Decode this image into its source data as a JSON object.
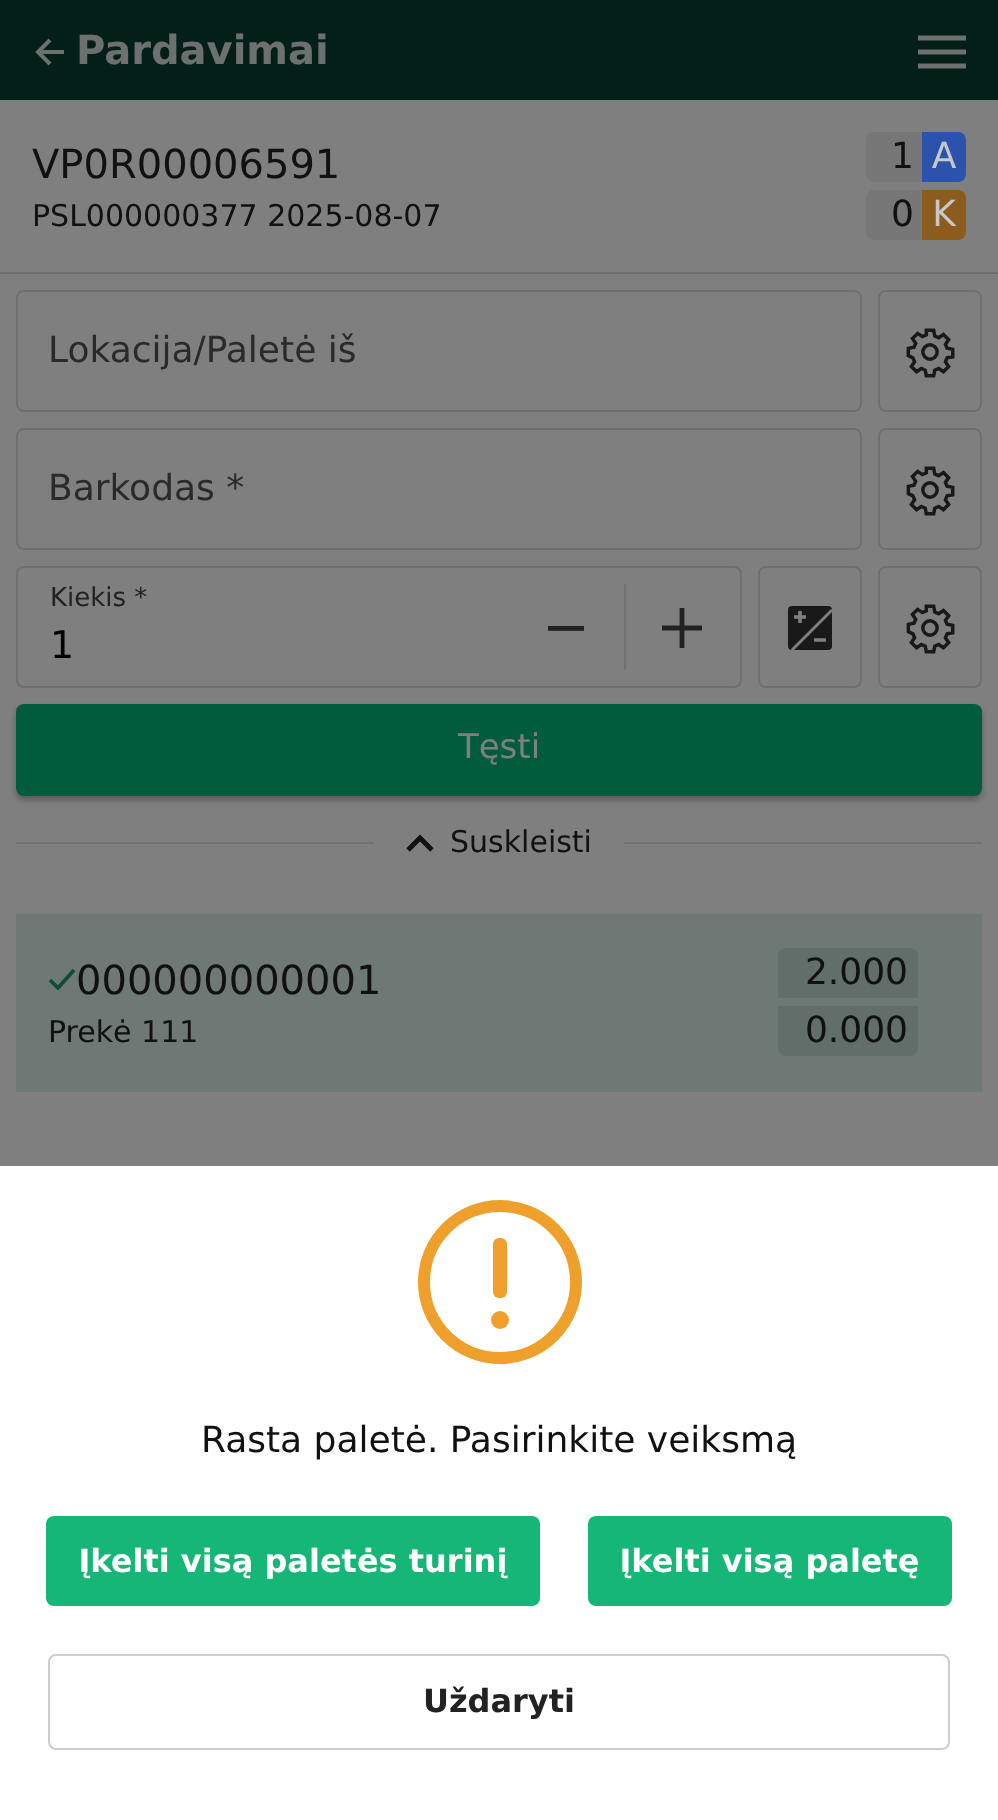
{
  "app_bar": {
    "title": "Pardavimai"
  },
  "document": {
    "number": "VP0R00006591",
    "subtitle": "PSL000000377 2025-08-07",
    "counters": [
      {
        "count": "1",
        "letter": "A",
        "color": "#2b52ad"
      },
      {
        "count": "0",
        "letter": "K",
        "color": "#8c5c1c"
      }
    ]
  },
  "fields": [
    {
      "kind": "text",
      "placeholder": "Lokacija/Paletė iš"
    },
    {
      "kind": "text",
      "placeholder": "Barkodas *"
    },
    {
      "kind": "quantity",
      "label": "Kiekis *",
      "value": "1"
    }
  ],
  "continue_button": "Tęsti",
  "collapse_link": "Suskleisti",
  "items": [
    {
      "code": "000000000001",
      "name": "Prekė 111",
      "checked": true,
      "quantities": [
        "2.000",
        "0.000"
      ]
    }
  ],
  "dialog": {
    "message": "Rasta paletė. Pasirinkite veiksmą",
    "actions": [
      "Įkelti visą paletės turinį",
      "Įkelti visą paletę"
    ],
    "close": "Uždaryti"
  }
}
